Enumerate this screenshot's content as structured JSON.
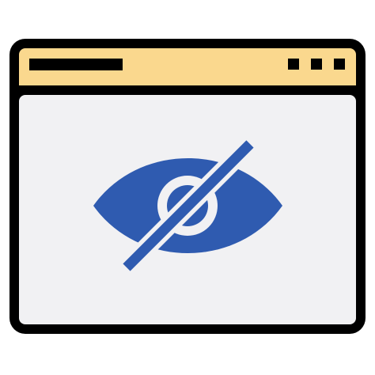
{
  "window": {
    "icon_name": "browser-window-icon",
    "colors": {
      "outline": "#000000",
      "title_bar": "#fad88e",
      "content": "#f1f1f3",
      "accent": "#2f5bb0"
    },
    "title_bar": {
      "title_placeholder_icon": "title-bar-line",
      "control_dots": [
        "window-control-dot",
        "window-control-dot",
        "window-control-dot"
      ]
    },
    "content": {
      "icon_name": "eye-slash-icon"
    }
  }
}
